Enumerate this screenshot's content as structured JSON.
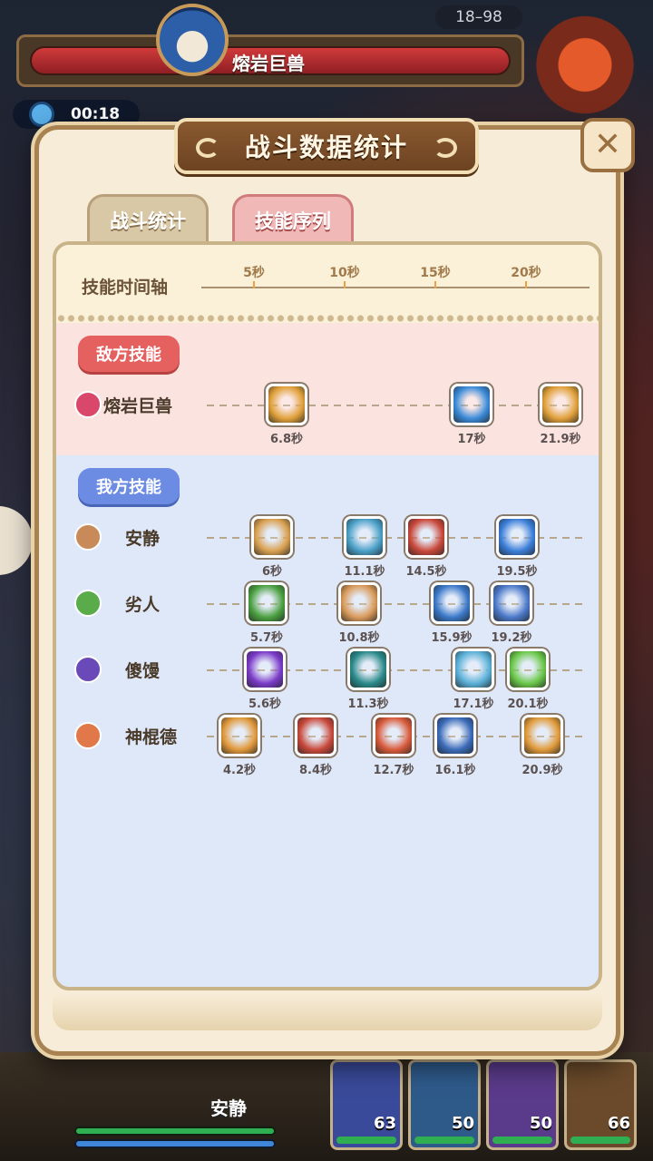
{
  "hud": {
    "boss_name": "熔岩巨兽",
    "level_range": "18–98",
    "timer": "00:18",
    "player_name": "安静",
    "hero_levels": [
      "63",
      "50",
      "50",
      "66"
    ]
  },
  "dialog": {
    "title": "战斗数据统计",
    "tabs": [
      {
        "label": "战斗统计",
        "active": false
      },
      {
        "label": "技能序列",
        "active": true
      }
    ],
    "timeline_label": "技能时间轴",
    "ticks": [
      "5秒",
      "10秒",
      "15秒",
      "20秒"
    ],
    "enemy_section_label": "敌方技能",
    "ally_section_label": "我方技能",
    "enemy_rows": [
      {
        "name": "熔岩巨兽",
        "icon": "claw-icon",
        "color": "#d9486a",
        "skills": [
          {
            "time": "6.8秒",
            "color": "#e0a03a"
          },
          {
            "time": "17秒",
            "color": "#3a8ad8"
          },
          {
            "time": "21.9秒",
            "color": "#e0a03a"
          }
        ]
      }
    ],
    "ally_rows": [
      {
        "name": "安静",
        "icon": "beast-icon",
        "color": "#c98a5a",
        "skills": [
          {
            "time": "6秒",
            "color": "#d9a050"
          },
          {
            "time": "11.1秒",
            "color": "#4aa0c8"
          },
          {
            "time": "14.5秒",
            "color": "#c9483a"
          },
          {
            "time": "19.5秒",
            "color": "#3a7ed8"
          }
        ]
      },
      {
        "name": "劣人",
        "icon": "leaf-icon",
        "color": "#5aab4a",
        "skills": [
          {
            "time": "5.7秒",
            "color": "#4aa040"
          },
          {
            "time": "10.8秒",
            "color": "#d99a5a"
          },
          {
            "time": "15.9秒",
            "color": "#3a78c8"
          },
          {
            "time": "19.2秒",
            "color": "#4a78c8"
          }
        ]
      },
      {
        "name": "傻馒",
        "icon": "rune-icon",
        "color": "#6a4ab8",
        "skills": [
          {
            "time": "5.6秒",
            "color": "#7a3ac8"
          },
          {
            "time": "11.3秒",
            "color": "#2a8a8a"
          },
          {
            "time": "17.1秒",
            "color": "#5ab0d8"
          },
          {
            "time": "20.1秒",
            "color": "#6ac84a"
          }
        ]
      },
      {
        "name": "神棍德",
        "icon": "paw-icon",
        "color": "#e0784a",
        "skills": [
          {
            "time": "4.2秒",
            "color": "#e0983a"
          },
          {
            "time": "8.4秒",
            "color": "#c8483a"
          },
          {
            "time": "12.7秒",
            "color": "#d85a3a"
          },
          {
            "time": "16.1秒",
            "color": "#3a6ab8"
          },
          {
            "time": "20.9秒",
            "color": "#e09a3a"
          }
        ]
      }
    ]
  }
}
